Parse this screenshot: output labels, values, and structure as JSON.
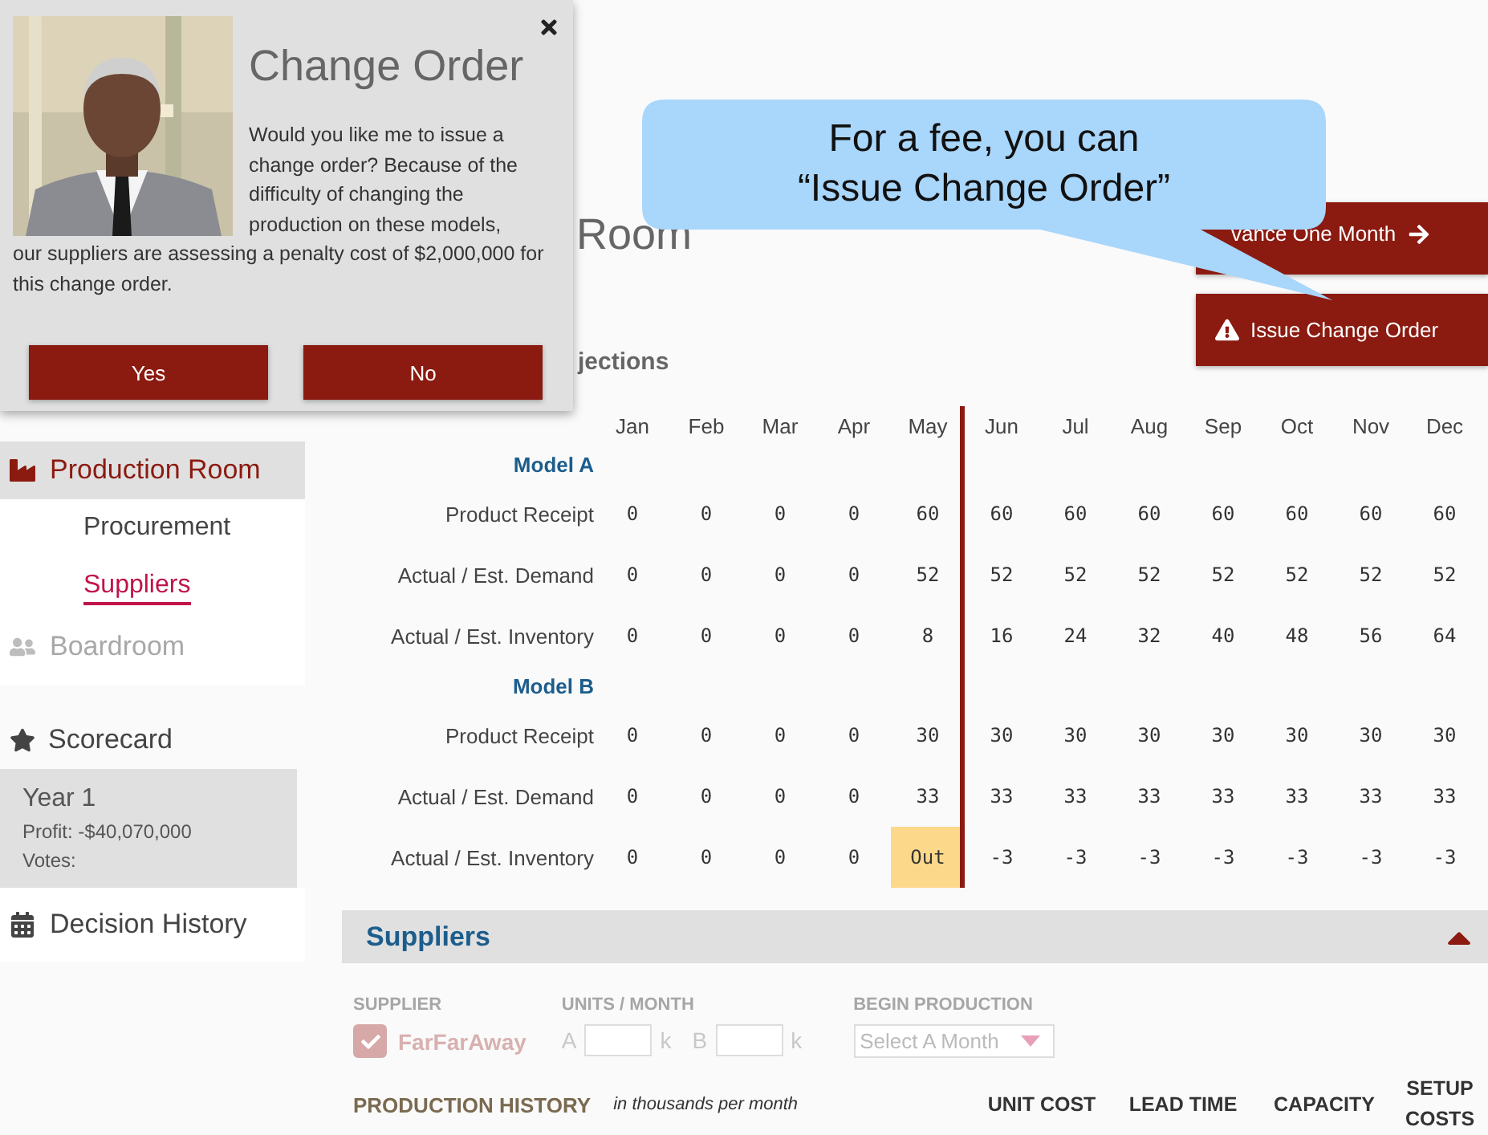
{
  "dialog": {
    "title": "Change Order",
    "message": [
      "Would you like me to issue a change order? Because of the difficulty of changing the production on these models,",
      "our suppliers are assessing a penalty cost of $2,000,000 for this change order."
    ],
    "buttons": [
      "Yes",
      "No"
    ]
  },
  "callout": {
    "lines": [
      "For a fee, you can",
      "“Issue Change Order”"
    ]
  },
  "sidebar": {
    "items": [
      {
        "label": "Production Room",
        "selected": true,
        "disabled": false,
        "children": [
          {
            "label": "Procurement",
            "selected": false
          },
          {
            "label": "Suppliers",
            "selected": true
          }
        ]
      },
      {
        "label": "Boardroom",
        "selected": false,
        "disabled": true
      }
    ],
    "scorecard": {
      "title": "Scorecard",
      "year": "Year 1",
      "profit": "Profit: -$40,070,000",
      "votes": "Votes:"
    },
    "history_link": "Decision History"
  },
  "page": {
    "title": "Room",
    "actions": [
      {
        "label": "vance One Month",
        "kind": "advance"
      },
      {
        "label": "Issue Change Order",
        "kind": "warning"
      }
    ]
  },
  "projections": {
    "heading": "jections",
    "months": [
      {
        "label": "Jan",
        "current": false
      },
      {
        "label": "Feb",
        "current": false
      },
      {
        "label": "Mar",
        "current": false
      },
      {
        "label": "Apr",
        "current": false
      },
      {
        "label": "May",
        "current": true
      },
      {
        "label": "Jun",
        "current": false
      },
      {
        "label": "Jul",
        "current": false
      },
      {
        "label": "Aug",
        "current": false
      },
      {
        "label": "Sep",
        "current": false
      },
      {
        "label": "Oct",
        "current": false
      },
      {
        "label": "Nov",
        "current": false
      },
      {
        "label": "Dec",
        "current": false
      }
    ],
    "rows": [
      {
        "kind": "group",
        "label": "Model A"
      },
      {
        "kind": "data",
        "label": "Product Receipt",
        "cells": [
          {
            "text": "0",
            "flagged": false
          },
          {
            "text": "0",
            "flagged": false
          },
          {
            "text": "0",
            "flagged": false
          },
          {
            "text": "0",
            "flagged": false
          },
          {
            "text": "60",
            "flagged": false
          },
          {
            "text": "60",
            "flagged": false
          },
          {
            "text": "60",
            "flagged": false
          },
          {
            "text": "60",
            "flagged": false
          },
          {
            "text": "60",
            "flagged": false
          },
          {
            "text": "60",
            "flagged": false
          },
          {
            "text": "60",
            "flagged": false
          },
          {
            "text": "60",
            "flagged": false
          }
        ]
      },
      {
        "kind": "data",
        "label": "Actual / Est. Demand",
        "cells": [
          {
            "text": "0",
            "flagged": false
          },
          {
            "text": "0",
            "flagged": false
          },
          {
            "text": "0",
            "flagged": false
          },
          {
            "text": "0",
            "flagged": false
          },
          {
            "text": "52",
            "flagged": false
          },
          {
            "text": "52",
            "flagged": false
          },
          {
            "text": "52",
            "flagged": false
          },
          {
            "text": "52",
            "flagged": false
          },
          {
            "text": "52",
            "flagged": false
          },
          {
            "text": "52",
            "flagged": false
          },
          {
            "text": "52",
            "flagged": false
          },
          {
            "text": "52",
            "flagged": false
          }
        ]
      },
      {
        "kind": "data",
        "label": "Actual / Est. Inventory",
        "cells": [
          {
            "text": "0",
            "flagged": false
          },
          {
            "text": "0",
            "flagged": false
          },
          {
            "text": "0",
            "flagged": false
          },
          {
            "text": "0",
            "flagged": false
          },
          {
            "text": "8",
            "flagged": false
          },
          {
            "text": "16",
            "flagged": false
          },
          {
            "text": "24",
            "flagged": false
          },
          {
            "text": "32",
            "flagged": false
          },
          {
            "text": "40",
            "flagged": false
          },
          {
            "text": "48",
            "flagged": false
          },
          {
            "text": "56",
            "flagged": false
          },
          {
            "text": "64",
            "flagged": false
          }
        ]
      },
      {
        "kind": "group",
        "label": "Model B"
      },
      {
        "kind": "data",
        "label": "Product Receipt",
        "cells": [
          {
            "text": "0",
            "flagged": false
          },
          {
            "text": "0",
            "flagged": false
          },
          {
            "text": "0",
            "flagged": false
          },
          {
            "text": "0",
            "flagged": false
          },
          {
            "text": "30",
            "flagged": false
          },
          {
            "text": "30",
            "flagged": false
          },
          {
            "text": "30",
            "flagged": false
          },
          {
            "text": "30",
            "flagged": false
          },
          {
            "text": "30",
            "flagged": false
          },
          {
            "text": "30",
            "flagged": false
          },
          {
            "text": "30",
            "flagged": false
          },
          {
            "text": "30",
            "flagged": false
          }
        ]
      },
      {
        "kind": "data",
        "label": "Actual / Est. Demand",
        "cells": [
          {
            "text": "0",
            "flagged": false
          },
          {
            "text": "0",
            "flagged": false
          },
          {
            "text": "0",
            "flagged": false
          },
          {
            "text": "0",
            "flagged": false
          },
          {
            "text": "33",
            "flagged": false
          },
          {
            "text": "33",
            "flagged": false
          },
          {
            "text": "33",
            "flagged": false
          },
          {
            "text": "33",
            "flagged": false
          },
          {
            "text": "33",
            "flagged": false
          },
          {
            "text": "33",
            "flagged": false
          },
          {
            "text": "33",
            "flagged": false
          },
          {
            "text": "33",
            "flagged": false
          }
        ]
      },
      {
        "kind": "data",
        "label": "Actual / Est. Inventory",
        "cells": [
          {
            "text": "0",
            "flagged": false
          },
          {
            "text": "0",
            "flagged": false
          },
          {
            "text": "0",
            "flagged": false
          },
          {
            "text": "0",
            "flagged": false
          },
          {
            "text": "Out",
            "flagged": true
          },
          {
            "text": "-3",
            "flagged": false
          },
          {
            "text": "-3",
            "flagged": false
          },
          {
            "text": "-3",
            "flagged": false
          },
          {
            "text": "-3",
            "flagged": false
          },
          {
            "text": "-3",
            "flagged": false
          },
          {
            "text": "-3",
            "flagged": false
          },
          {
            "text": "-3",
            "flagged": false
          }
        ]
      }
    ]
  },
  "suppliers": {
    "title": "Suppliers",
    "expanded": true,
    "form": {
      "disabled": true,
      "supplier_label": "SUPPLIER",
      "supplier": {
        "name": "FarFarAway",
        "checked": true
      },
      "units_label": "UNITS / MONTH",
      "units": [
        {
          "prefix": "A",
          "suffix": "k"
        },
        {
          "prefix": "B",
          "suffix": "k"
        }
      ],
      "begin_label": "BEGIN PRODUCTION",
      "month_select": {
        "placeholder": "Select A Month"
      }
    },
    "history": {
      "title": "PRODUCTION HISTORY",
      "note": "in thousands per month",
      "columns": [
        "UNIT COST",
        "LEAD TIME",
        "CAPACITY",
        "SETUP COSTS"
      ]
    }
  }
}
